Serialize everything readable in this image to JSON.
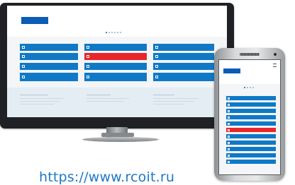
{
  "caption": "https://www.rcoit.ru",
  "brand_color": "#0a5cb5",
  "tile_color": "#0f79c6",
  "alert_color": "#e8262b",
  "icons": [
    "monitor-icon",
    "smartphone-icon"
  ]
}
